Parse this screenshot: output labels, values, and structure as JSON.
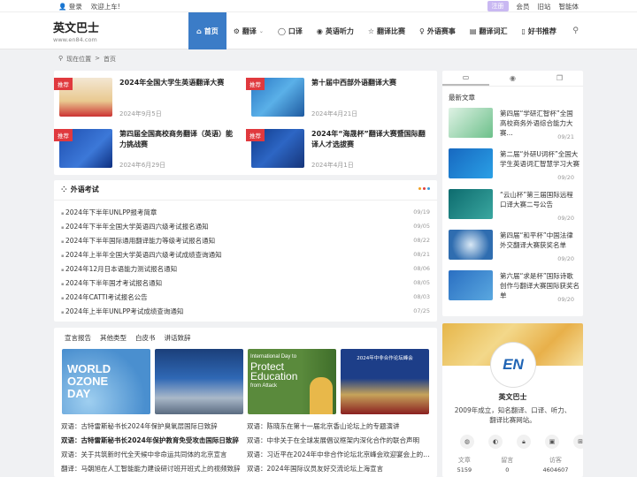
{
  "topbar": {
    "login": "登录",
    "welcome": "欢迎上车!",
    "register": "注册",
    "member": "会员",
    "old": "旧站",
    "smart": "智能体"
  },
  "site": {
    "name": "英文巴士",
    "domain": "www.en84.com"
  },
  "nav": [
    {
      "label": "首页",
      "icon": "home-icon"
    },
    {
      "label": "翻译",
      "icon": "gear-icon"
    },
    {
      "label": "口译",
      "icon": "chat-icon"
    },
    {
      "label": "英语听力",
      "icon": "headphone-icon"
    },
    {
      "label": "翻译比赛",
      "icon": "star-icon"
    },
    {
      "label": "外语赛事",
      "icon": "trophy-icon"
    },
    {
      "label": "翻译词汇",
      "icon": "list-icon"
    },
    {
      "label": "好书推荐",
      "icon": "book-icon"
    }
  ],
  "breadcrumb": {
    "current": "现在位置",
    "sep": ">",
    "home": "首页"
  },
  "featured": [
    {
      "tag": "推荐",
      "title": "2024年全国大学生英语翻译大赛",
      "date": "2024年9月5日"
    },
    {
      "tag": "推荐",
      "title": "第十届中西部外语翻译大赛",
      "date": "2024年4月21日"
    },
    {
      "tag": "推荐",
      "title": "第四届全国高校商务翻译（英语）能力挑战赛",
      "date": "2024年6月29日"
    },
    {
      "tag": "推荐",
      "title": "2024年“海晟杯”翻译大赛暨国际翻译人才选拔赛",
      "date": "2024年4月1日"
    }
  ],
  "exam": {
    "title": "外语考试",
    "items": [
      {
        "t": "2024年下半年UNLPP报考简章",
        "d": "09/19"
      },
      {
        "t": "2024年下半年全国大学英语四六级考试报名通知",
        "d": "09/05"
      },
      {
        "t": "2024年下半年国际通用翻译能力等级考试报名通知",
        "d": "08/22"
      },
      {
        "t": "2024年上半年全国大学英语四六级考试成绩查询通知",
        "d": "08/21"
      },
      {
        "t": "2024年12月日本语能力测试报名通知",
        "d": "08/06"
      },
      {
        "t": "2024年下半年国才考试报名通知",
        "d": "08/05"
      },
      {
        "t": "2024年CATTI考试报名公告",
        "d": "08/03"
      },
      {
        "t": "2024年上半年UNLPP考试成绩查询通知",
        "d": "07/25"
      }
    ]
  },
  "news": {
    "tabs": [
      "宣言报告",
      "其他类型",
      "白皮书",
      "讲话致辞"
    ],
    "pics": [
      {
        "l1": "WORLD",
        "l2": "OZONE",
        "l3": "DAY"
      },
      {
        "l1": "",
        "l2": "",
        "l3": ""
      },
      {
        "l1": "International Day to",
        "l2": "Protect",
        "l3": "Education"
      },
      {
        "l1": "2024年中非合作论坛峰会",
        "l2": "",
        "l3": ""
      }
    ],
    "pic3_sub": "from Attack",
    "items": [
      {
        "t": "双语：古特雷斯秘书长2024年保护臭氧层国际日致辞",
        "b": false
      },
      {
        "t": "双语：陈晓东在第十一届北京香山论坛上的专题演讲",
        "b": false
      },
      {
        "t": "双语：古特雷斯秘书长2024年保护教育免受攻击国际日致辞",
        "b": true
      },
      {
        "t": "双语：中非关于在全球发展倡议框架内深化合作的联合声明",
        "b": false
      },
      {
        "t": "双语：关于共筑新时代全天候中非命运共同体的北京宣言",
        "b": false
      },
      {
        "t": "双语：习近平在2024年中非合作论坛北京峰会欢迎宴会上的致辞",
        "b": false
      },
      {
        "t": "翻译：马朝旭在人工智能能力建设研讨班开班式上的视频致辞",
        "b": false
      },
      {
        "t": "双语：2024年国际议员友好交流论坛上海宣言",
        "b": false
      }
    ]
  },
  "sidebar": {
    "heading": "最新文章",
    "items": [
      {
        "t": "第四届“学研汇智杯”全国高校商务外语综合能力大赛...",
        "d": "09/21"
      },
      {
        "t": "第二届“外研U词杯”全国大学生英语词汇智慧学习大赛",
        "d": "09/20"
      },
      {
        "t": "“云山杯”第三届国际远程口译大赛二号公告",
        "d": "09/20"
      },
      {
        "t": "第四届“和平杯”中国法律外交翻译大赛获奖名单",
        "d": "09/20"
      },
      {
        "t": "第六届“求是杯”国际诗歌创作与翻译大赛国际获奖名单",
        "d": "09/20"
      }
    ]
  },
  "profile": {
    "name": "英文巴士",
    "desc": "2009年成立，知名翻译、口译、听力、翻译比赛网站。",
    "logo": "EN",
    "stats": [
      {
        "label": "文章",
        "value": "5159"
      },
      {
        "label": "留言",
        "value": "0"
      },
      {
        "label": "访客",
        "value": "4604607"
      }
    ]
  },
  "colors": {
    "accent": "#3b7cc7",
    "tag": "#e0393e"
  }
}
